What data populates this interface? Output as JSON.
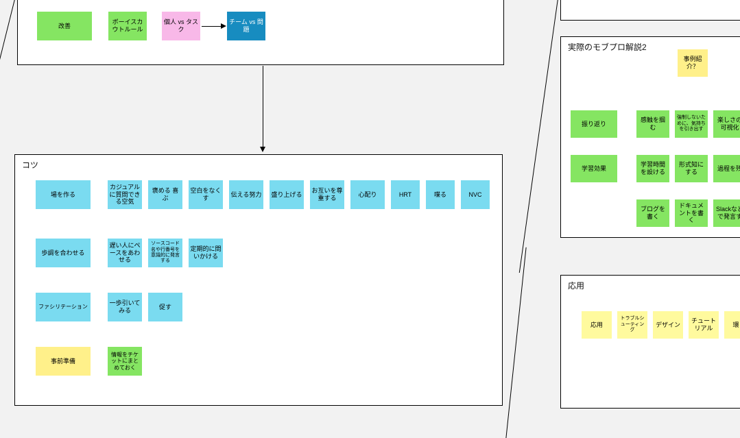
{
  "topFrame": {
    "notes": {
      "improve": "改善",
      "boyscout": "ボーイスカウトルール",
      "ind_task": "個人 vs タスク",
      "team_problem": "チーム vs 問題"
    }
  },
  "leftFrame": {
    "title": "コツ",
    "row1": [
      "場を作る",
      "カジュアルに質問できる空気",
      "褒める 喜ぶ",
      "空白をなくす",
      "伝える努力",
      "盛り上げる",
      "お互いを尊重する",
      "心配り",
      "HRT",
      "喋る",
      "NVC"
    ],
    "row2": [
      "歩調を合わせる",
      "遅い人にペースをあわせる",
      "ソースコード名や行番号を意識的に発言する",
      "定期的に問いかける"
    ],
    "row3": [
      "ファシリテーション",
      "一歩引いてみる",
      "促す"
    ],
    "row4a": "事前準備",
    "row4b": "情報をチケットにまとめておく"
  },
  "rightFrame1": {
    "title": "実際のモブプロ解説2",
    "highlight": "事例紹介？",
    "r1": [
      "振り返り",
      "感触を掴む",
      "強制しないために、気持ちを引き出す",
      "楽しさの可視化"
    ],
    "r2": [
      "学習効果",
      "学習時間を設ける",
      "形式知にする",
      "過程を残"
    ],
    "r3": [
      "ブログを書く",
      "ドキュメントを書く",
      "Slackなどで発言す"
    ]
  },
  "rightFrame2": {
    "title": "応用",
    "row": [
      "応用",
      "トラブルシューティング",
      "デザイン",
      "チュートリアル",
      "環"
    ]
  }
}
